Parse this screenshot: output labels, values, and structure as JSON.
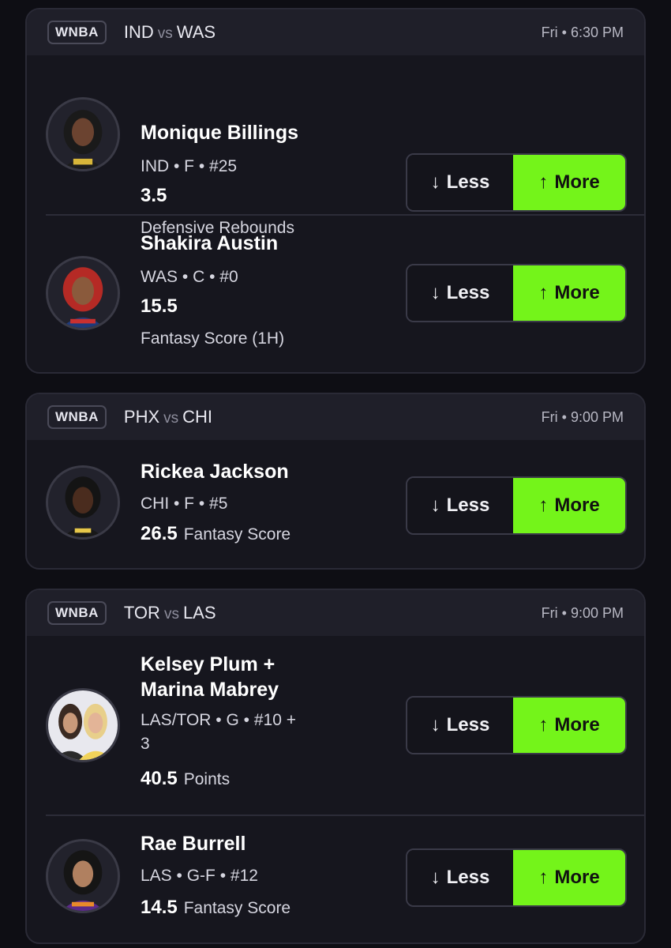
{
  "accent_color": "#74f41a",
  "cards": [
    {
      "league": "WNBA",
      "home": "IND",
      "vs": "vs",
      "away": "WAS",
      "time": "Fri • 6:30 PM",
      "players": [
        {
          "name": "Monique Billings",
          "meta": "IND • F • #25",
          "line": "3.5",
          "stat": "Defensive Rebounds"
        },
        {
          "name": "Shakira Austin",
          "meta": "WAS • C • #0",
          "line": "15.5",
          "stat": "Fantasy Score (1H)"
        }
      ]
    },
    {
      "league": "WNBA",
      "home": "PHX",
      "vs": "vs",
      "away": "CHI",
      "time": "Fri • 9:00 PM",
      "players": [
        {
          "name": "Rickea Jackson",
          "meta": "CHI • F • #5",
          "line": "26.5",
          "stat": "Fantasy Score"
        }
      ]
    },
    {
      "league": "WNBA",
      "home": "TOR",
      "vs": "vs",
      "away": "LAS",
      "time": "Fri • 9:00 PM",
      "players": [
        {
          "name_line1": "Kelsey Plum +",
          "name_line2": "Marina Mabrey",
          "meta_line1": "LAS/TOR • G • #10 +",
          "meta_line2": "3",
          "line": "40.5",
          "stat": "Points"
        },
        {
          "name": "Rae Burrell",
          "meta": "LAS • G-F • #12",
          "line": "14.5",
          "stat": "Fantasy Score"
        }
      ]
    }
  ],
  "pick": {
    "less_label": "Less",
    "more_label": "More",
    "less_icon": "arrow-down-icon",
    "more_icon": "arrow-up-icon"
  }
}
